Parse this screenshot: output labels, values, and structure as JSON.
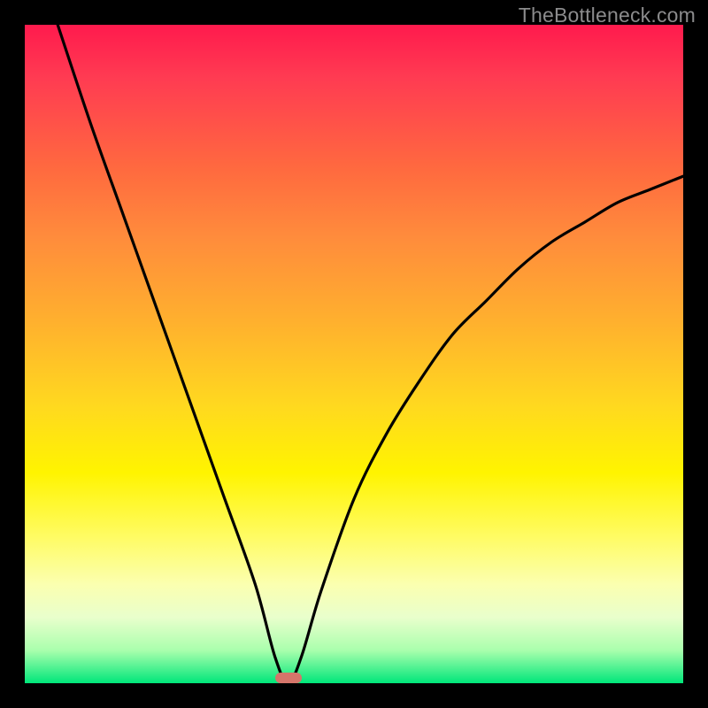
{
  "watermark": "TheBottleneck.com",
  "chart_data": {
    "type": "line",
    "title": "",
    "xlabel": "",
    "ylabel": "",
    "xlim": [
      0,
      100
    ],
    "ylim": [
      0,
      100
    ],
    "series": [
      {
        "name": "curve",
        "x": [
          5,
          10,
          15,
          20,
          25,
          30,
          35,
          38,
          40,
          42,
          45,
          50,
          55,
          60,
          65,
          70,
          75,
          80,
          85,
          90,
          95,
          100
        ],
        "y": [
          100,
          85,
          71,
          57,
          43,
          29,
          15,
          4,
          0,
          4,
          14,
          28,
          38,
          46,
          53,
          58,
          63,
          67,
          70,
          73,
          75,
          77
        ]
      }
    ],
    "marker": {
      "x": 40,
      "y": 0
    },
    "gradient_stops": [
      {
        "pos": 0,
        "color": "#ff1a4d"
      },
      {
        "pos": 22,
        "color": "#ff6a3f"
      },
      {
        "pos": 45,
        "color": "#ffb02e"
      },
      {
        "pos": 68,
        "color": "#fff400"
      },
      {
        "pos": 90,
        "color": "#e9ffcc"
      },
      {
        "pos": 100,
        "color": "#00e67a"
      }
    ]
  }
}
